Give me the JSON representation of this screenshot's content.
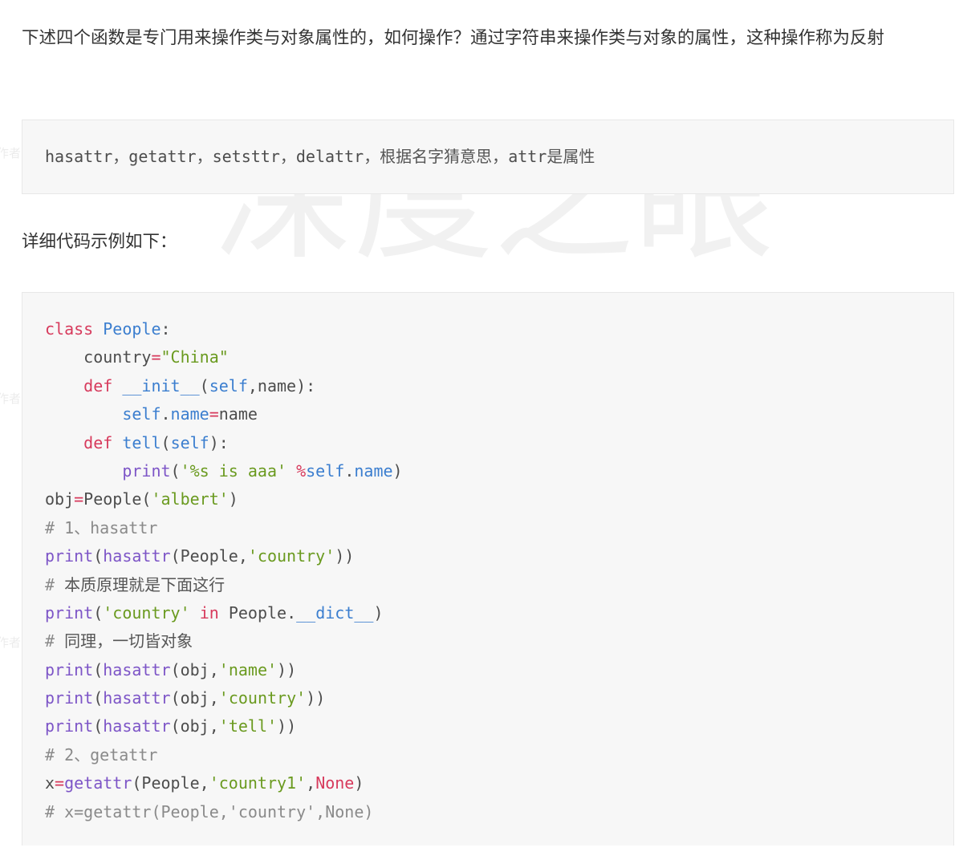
{
  "intro_paragraph": "下述四个函数是专门用来操作类与对象属性的，如何操作？通过字符串来操作类与对象的属性，这种操作称为反射",
  "detail_paragraph": "详细代码示例如下：",
  "watermark_text": "深度之眼",
  "side_watermark_text": "作者",
  "functions_code": [
    [
      [
        "plain",
        "hasattr"
      ],
      [
        "cjk",
        "，"
      ],
      [
        "plain",
        "getattr"
      ],
      [
        "cjk",
        "，"
      ],
      [
        "plain",
        "setsttr"
      ],
      [
        "cjk",
        "，"
      ],
      [
        "plain",
        "delattr"
      ],
      [
        "cjk",
        "，根据名字猜意思，"
      ],
      [
        "plain",
        "attr"
      ],
      [
        "cjk",
        "是属性"
      ]
    ]
  ],
  "example_code": [
    [
      [
        "keyword",
        "class"
      ],
      [
        "plain",
        " "
      ],
      [
        "classname",
        "People"
      ],
      [
        "plain",
        ":"
      ]
    ],
    [
      [
        "plain",
        "    country"
      ],
      [
        "operator",
        "="
      ],
      [
        "string",
        "\"China\""
      ]
    ],
    [
      [
        "plain",
        "    "
      ],
      [
        "keyword",
        "def"
      ],
      [
        "plain",
        " "
      ],
      [
        "magic",
        "__init__"
      ],
      [
        "plain",
        "("
      ],
      [
        "self",
        "self"
      ],
      [
        "plain",
        ",name):"
      ]
    ],
    [
      [
        "plain",
        "        "
      ],
      [
        "self",
        "self"
      ],
      [
        "plain",
        "."
      ],
      [
        "attr",
        "name"
      ],
      [
        "operator",
        "="
      ],
      [
        "plain",
        "name"
      ]
    ],
    [
      [
        "plain",
        "    "
      ],
      [
        "keyword",
        "def"
      ],
      [
        "plain",
        " "
      ],
      [
        "attr",
        "tell"
      ],
      [
        "plain",
        "("
      ],
      [
        "self",
        "self"
      ],
      [
        "plain",
        "):"
      ]
    ],
    [
      [
        "plain",
        "        "
      ],
      [
        "builtin",
        "print"
      ],
      [
        "plain",
        "("
      ],
      [
        "string",
        "'%s is aaa'"
      ],
      [
        "plain",
        " "
      ],
      [
        "operator",
        "%"
      ],
      [
        "self",
        "self"
      ],
      [
        "plain",
        "."
      ],
      [
        "attr",
        "name"
      ],
      [
        "plain",
        ")"
      ]
    ],
    [
      [
        "plain",
        "obj"
      ],
      [
        "operator",
        "="
      ],
      [
        "plain",
        "People("
      ],
      [
        "string",
        "'albert'"
      ],
      [
        "plain",
        ")"
      ]
    ],
    [
      [
        "comment",
        "# 1、hasattr"
      ]
    ],
    [
      [
        "builtin",
        "print"
      ],
      [
        "plain",
        "("
      ],
      [
        "builtin",
        "hasattr"
      ],
      [
        "plain",
        "(People,"
      ],
      [
        "string",
        "'country'"
      ],
      [
        "plain",
        "))"
      ]
    ],
    [
      [
        "comment",
        "# "
      ],
      [
        "cjk",
        "本质原理就是下面这行"
      ]
    ],
    [
      [
        "builtin",
        "print"
      ],
      [
        "plain",
        "("
      ],
      [
        "string",
        "'country'"
      ],
      [
        "plain",
        " "
      ],
      [
        "keyword",
        "in"
      ],
      [
        "plain",
        " People."
      ],
      [
        "magic",
        "__dict__"
      ],
      [
        "plain",
        ")"
      ]
    ],
    [
      [
        "comment",
        "# "
      ],
      [
        "cjk",
        "同理，一切皆对象"
      ]
    ],
    [
      [
        "builtin",
        "print"
      ],
      [
        "plain",
        "("
      ],
      [
        "builtin",
        "hasattr"
      ],
      [
        "plain",
        "(obj,"
      ],
      [
        "string",
        "'name'"
      ],
      [
        "plain",
        "))"
      ]
    ],
    [
      [
        "builtin",
        "print"
      ],
      [
        "plain",
        "("
      ],
      [
        "builtin",
        "hasattr"
      ],
      [
        "plain",
        "(obj,"
      ],
      [
        "string",
        "'country'"
      ],
      [
        "plain",
        "))"
      ]
    ],
    [
      [
        "builtin",
        "print"
      ],
      [
        "plain",
        "("
      ],
      [
        "builtin",
        "hasattr"
      ],
      [
        "plain",
        "(obj,"
      ],
      [
        "string",
        "'tell'"
      ],
      [
        "plain",
        "))"
      ]
    ],
    [
      [
        "comment",
        "# 2、getattr"
      ]
    ],
    [
      [
        "plain",
        "x"
      ],
      [
        "operator",
        "="
      ],
      [
        "builtin",
        "getattr"
      ],
      [
        "plain",
        "(People,"
      ],
      [
        "string",
        "'country1'"
      ],
      [
        "plain",
        ","
      ],
      [
        "constant",
        "None"
      ],
      [
        "plain",
        ")"
      ]
    ],
    [
      [
        "comment",
        "# x=getattr(People,'country',None)"
      ]
    ]
  ]
}
